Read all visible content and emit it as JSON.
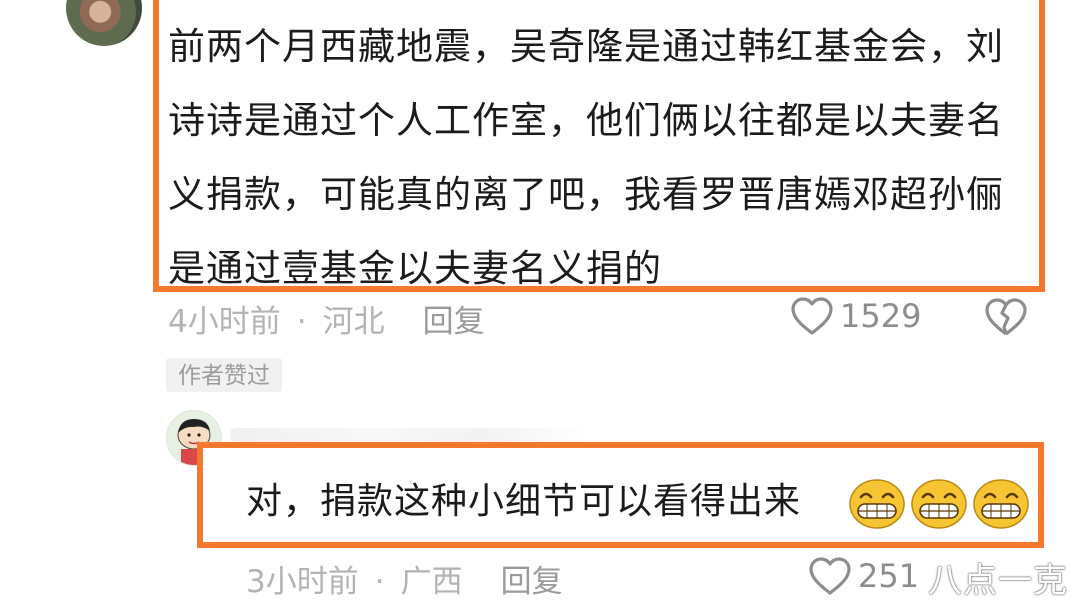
{
  "comment1": {
    "text": "前两个月西藏地震，吴奇隆是通过韩红基金会，刘诗诗是通过个人工作室，他们俩以往都是以夫妻名义捐款，可能真的离了吧，我看罗晋唐嫣邓超孙俪是通过壹基金以夫妻名义捐的",
    "time": "4小时前",
    "separator": "·",
    "location": "河北",
    "reply_label": "回复",
    "likes": "1529",
    "author_tag": "作者赞过"
  },
  "reply1": {
    "text": "对，捐款这种小细节可以看得出来",
    "emoji_count": 3,
    "time": "3小时前",
    "separator": "·",
    "location": "广西",
    "reply_label": "回复",
    "likes": "251"
  },
  "watermark": "八点一克",
  "colors": {
    "highlight": "#f4792e",
    "meta_text": "#b3b3b3",
    "body_text": "#1b1b1b"
  }
}
